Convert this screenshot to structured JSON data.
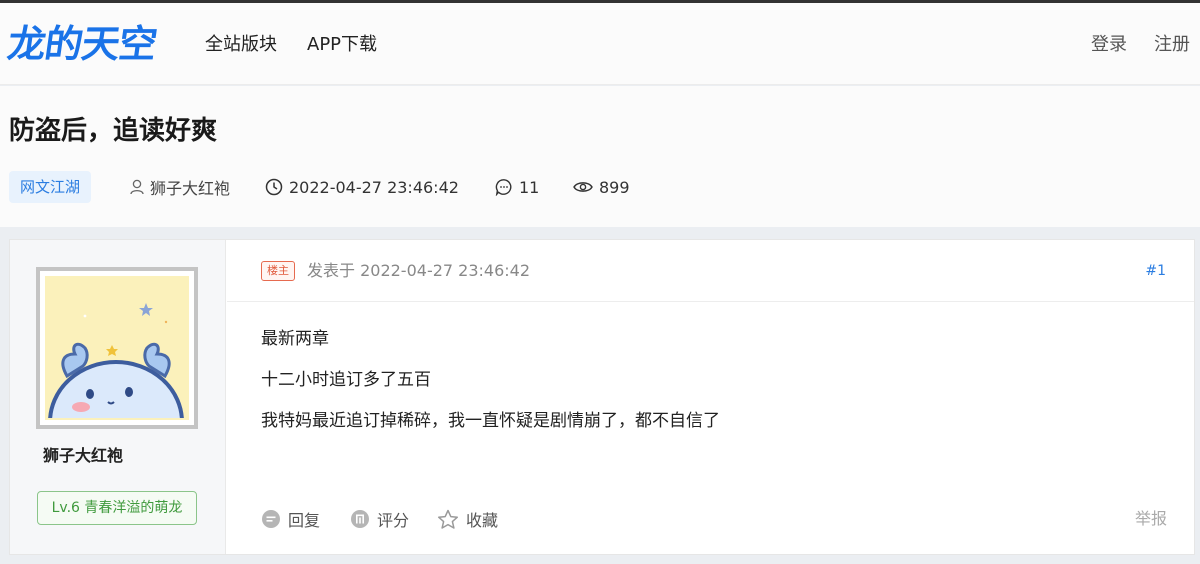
{
  "header": {
    "logo_text": "龙的天空",
    "nav": [
      {
        "label": "全站版块"
      },
      {
        "label": "APP下载"
      }
    ],
    "login_label": "登录",
    "register_label": "注册"
  },
  "thread": {
    "title": "防盗后，追读好爽",
    "forum_tag": "网文江湖",
    "author": "狮子大红袍",
    "datetime": "2022-04-27 23:46:42",
    "reply_count": "11",
    "view_count": "899"
  },
  "post": {
    "author_name": "狮子大红袍",
    "author_level": "Lv.6 青春洋溢的萌龙",
    "op_badge": "楼主",
    "posted_at": "发表于 2022-04-27 23:46:42",
    "floor": "#1",
    "lines": [
      "最新两章",
      "十二小时追订多了五百",
      "我特妈最近追订掉稀碎，我一直怀疑是剧情崩了，都不自信了"
    ],
    "actions": {
      "reply": "回复",
      "rate": "评分",
      "favorite": "收藏",
      "report": "举报"
    }
  },
  "colors": {
    "brand": "#1a73e8",
    "tag_bg": "#e8f2fd",
    "op_badge": "#e05a3c",
    "level_green": "#3f9a3d"
  },
  "icons": [
    "user-icon",
    "clock-icon",
    "comment-icon",
    "eye-icon",
    "reply-icon",
    "rate-icon",
    "star-icon"
  ]
}
